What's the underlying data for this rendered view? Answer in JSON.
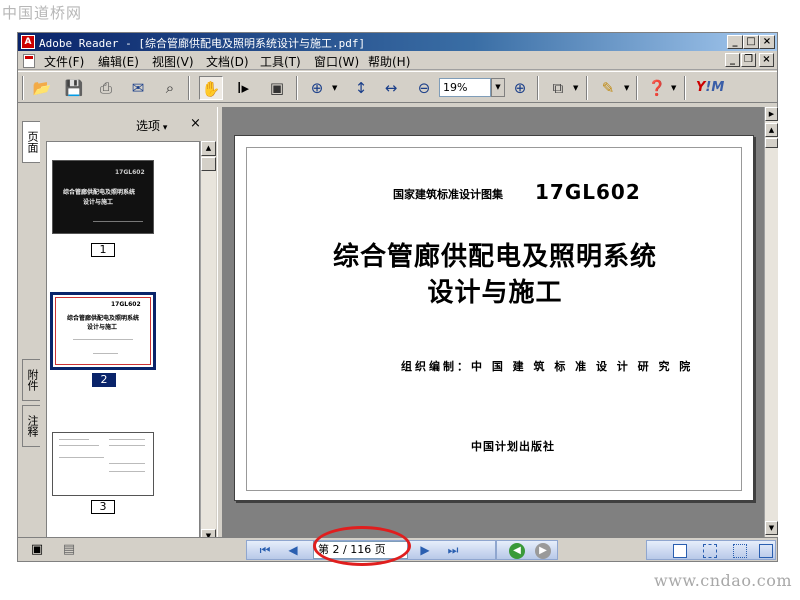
{
  "site": {
    "logo_text": "中国道桥网",
    "watermark": "www.cndao.com"
  },
  "window": {
    "title": "Adobe Reader - [综合管廊供配电及照明系统设计与施工.pdf]",
    "app_icon": "adobe-reader-icon",
    "caption_buttons": {
      "minimize": "_",
      "maximize": "□",
      "close": "×"
    }
  },
  "menu": {
    "items": [
      "文件(F)",
      "编辑(E)",
      "视图(V)",
      "文档(D)",
      "工具(T)",
      "窗口(W)",
      "帮助(H)"
    ],
    "doc_buttons": {
      "minimize": "_",
      "restore": "❐",
      "close": "×"
    }
  },
  "toolbar": {
    "zoom_value": "19%",
    "icons": [
      "open-icon",
      "save-icon",
      "print-icon",
      "email-icon",
      "search-icon",
      "hand-tool-icon",
      "select-text-icon",
      "snapshot-icon",
      "zoom-in-icon",
      "fit-page-icon",
      "fit-width-icon",
      "zoom-out-icon",
      "zoom-in-plus-icon",
      "pages-icon",
      "comment-icon",
      "help-icon"
    ],
    "brand": {
      "y": "Y",
      "rest": "!M"
    }
  },
  "nav_pane": {
    "options_label": "选项",
    "close_label": "×",
    "tabs": [
      "页面",
      "附件",
      "注释"
    ],
    "thumbnails": [
      {
        "number": "1",
        "code": "17GL602",
        "title": "综合管廊供配电及照明系统",
        "title2": "设计与施工"
      },
      {
        "number": "2",
        "code": "17GL602",
        "title": "综合管廊供配电及照明系统",
        "title2": "设计与施工"
      },
      {
        "number": "3"
      }
    ]
  },
  "document": {
    "series_label": "国家建筑标准设计图集",
    "code": "17GL602",
    "title_line1": "综合管廊供配电及照明系统",
    "title_line2": "设计与施工",
    "editor": "组织编制：中 国 建 筑 标 准 设 计 研 究 院",
    "publisher": "中国计划出版社"
  },
  "statusbar": {
    "page_indicator": "第 2 ∕ 116 页",
    "current_page": 2,
    "total_pages": 116
  },
  "colors": {
    "highlight": "#e01e1e",
    "selection": "#0a246a",
    "title_bar": "#0a246a"
  }
}
